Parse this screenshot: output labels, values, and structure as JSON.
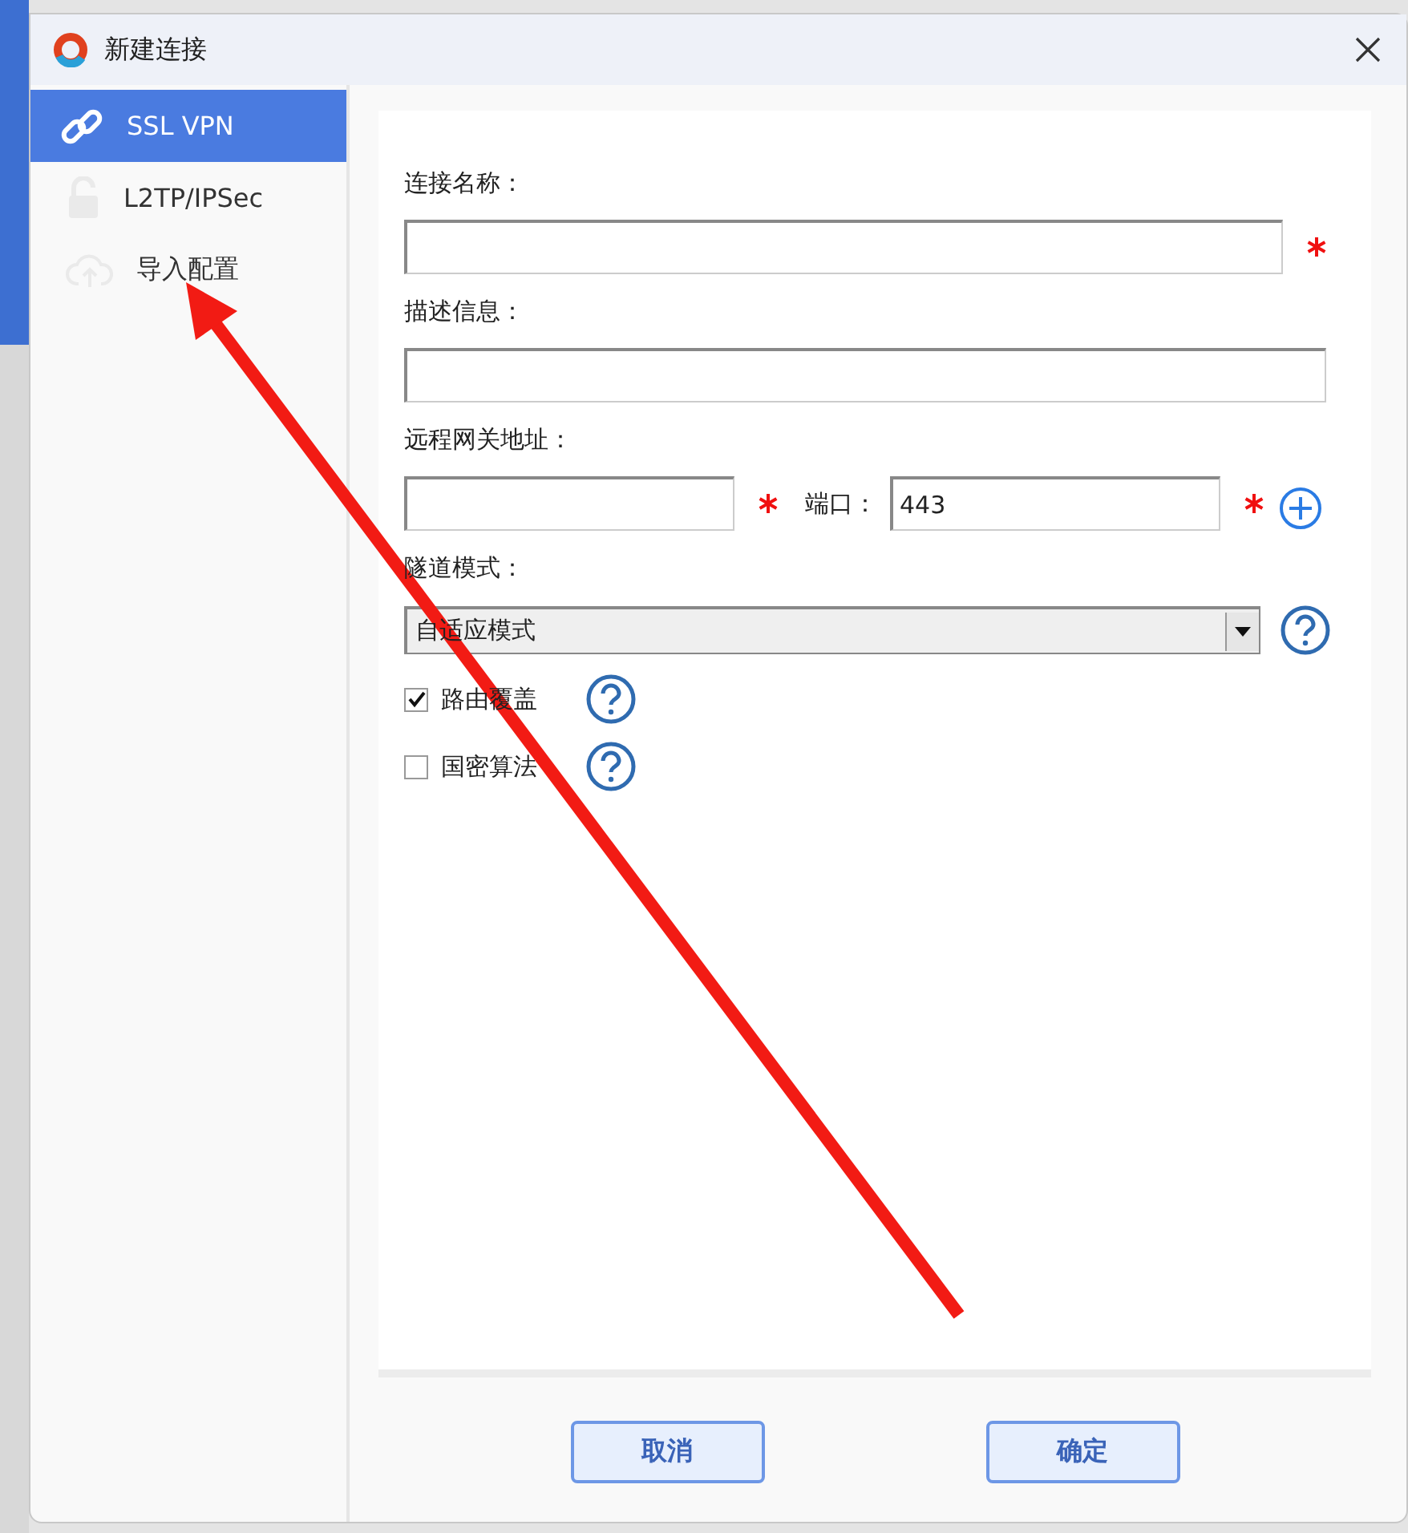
{
  "window": {
    "title": "新建连接"
  },
  "sidebar": {
    "items": [
      {
        "label": "SSL VPN",
        "selected": true
      },
      {
        "label": "L2TP/IPSec",
        "selected": false
      },
      {
        "label": "导入配置",
        "selected": false
      }
    ]
  },
  "form": {
    "fields": [
      {
        "kind": "text",
        "label": "连接名称：",
        "required": true
      },
      {
        "kind": "text",
        "label": "描述信息：",
        "required": false
      },
      {
        "kind": "gateway",
        "label": "远程网关地址：",
        "required": true,
        "port_label": "端口：",
        "port_value": "443",
        "port_required": true
      },
      {
        "kind": "select",
        "label": "隧道模式：",
        "value": "自适应模式"
      },
      {
        "kind": "checkbox",
        "label": "路由覆盖",
        "checked": true
      },
      {
        "kind": "checkbox",
        "label": "国密算法",
        "checked": false
      }
    ]
  },
  "buttons": [
    "取消",
    "确定"
  ]
}
